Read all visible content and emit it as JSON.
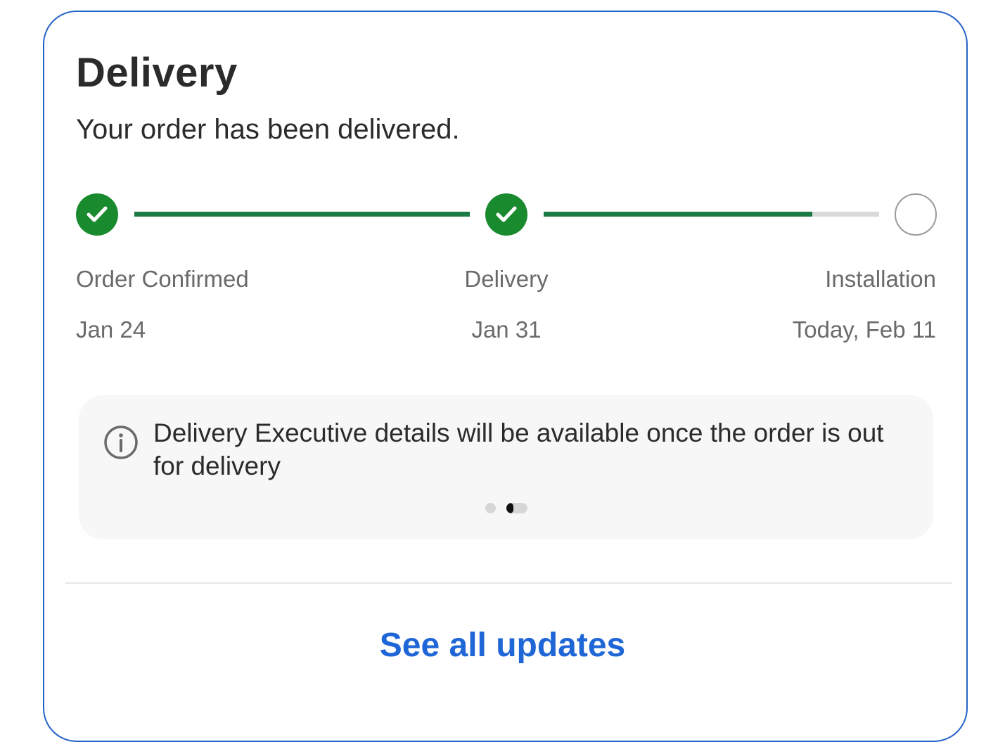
{
  "card": {
    "title": "Delivery",
    "subtitle": "Your order has been delivered.",
    "border_color": "#2563c9"
  },
  "progress": {
    "steps": [
      {
        "label": "Order Confirmed",
        "date": "Jan 24",
        "status": "done",
        "icon": "check-icon"
      },
      {
        "label": "Delivery",
        "date": "Jan 31",
        "status": "done",
        "icon": "check-icon"
      },
      {
        "label": "Installation",
        "date": "Today, Feb 11",
        "status": "pending",
        "icon": "empty-circle-icon"
      }
    ],
    "segments": [
      {
        "fill": 1.0
      },
      {
        "fill": 0.8
      }
    ],
    "done_color": "#1a8a2e",
    "track_fill_color": "#1a7a43"
  },
  "info": {
    "icon": "info-icon",
    "text": "Delivery Executive details will be available once the order is out for delivery",
    "carousel_pages": 2,
    "carousel_active": 2
  },
  "footer": {
    "link_label": "See all updates",
    "link_color": "#1f66d6"
  }
}
